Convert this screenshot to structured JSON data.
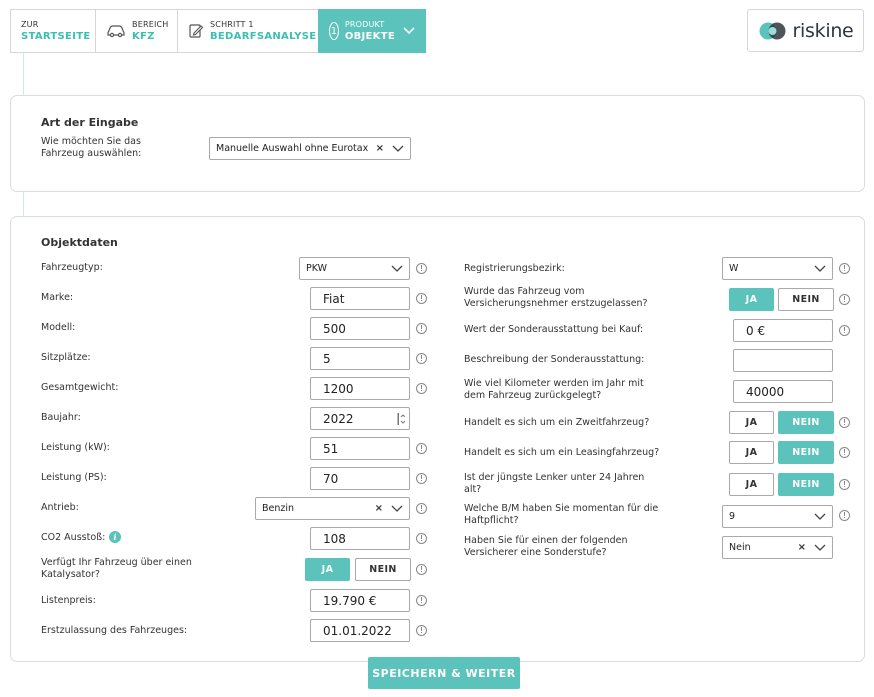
{
  "nav": {
    "home": {
      "small": "ZUR",
      "big": "STARTSEITE"
    },
    "area": {
      "small": "BEREICH",
      "big": "KFZ"
    },
    "step": {
      "small": "SCHRITT 1",
      "big": "BEDARFSANALYSE"
    },
    "product": {
      "small": "PRODUKT",
      "big": "OBJEKTE",
      "number": "1"
    }
  },
  "brand": {
    "name": "riskine",
    "accent": "#5bc3bb"
  },
  "input_type": {
    "title": "Art der Eingabe",
    "question": "Wie möchten Sie das Fahrzeug auswählen:",
    "selected": "Manuelle Auswahl ohne Eurotax"
  },
  "object": {
    "title": "Objektdaten",
    "vehicle_type": {
      "label": "Fahrzeugtyp:",
      "value": "PKW"
    },
    "brand": {
      "label": "Marke:",
      "value": "Fiat"
    },
    "model": {
      "label": "Modell:",
      "value": "500"
    },
    "seats": {
      "label": "Sitzplätze:",
      "value": "5"
    },
    "weight": {
      "label": "Gesamtgewicht:",
      "value": "1200"
    },
    "year": {
      "label": "Baujahr:",
      "value": "2022"
    },
    "power_kw": {
      "label": "Leistung (kW):",
      "value": "51"
    },
    "power_ps": {
      "label": "Leistung (PS):",
      "value": "70"
    },
    "drive": {
      "label": "Antrieb:",
      "value": "Benzin"
    },
    "co2": {
      "label": "CO2 Ausstoß:",
      "value": "108"
    },
    "catalyst": {
      "label": "Verfügt Ihr Fahrzeug über einen Katalysator?",
      "yes": "JA",
      "no": "NEIN",
      "selected": "JA"
    },
    "list_price": {
      "label": "Listenpreis:",
      "value": "19.790 €"
    },
    "first_registration": {
      "label": "Erstzulassung des Fahrzeuges:",
      "value": "01.01.2022"
    },
    "district": {
      "label": "Registrierungsbezirk:",
      "value": "W"
    },
    "first_registered_by_holder": {
      "label": "Wurde das Fahrzeug vom Versicherungsnehmer erstzugelassen?",
      "yes": "JA",
      "no": "NEIN",
      "selected": "JA"
    },
    "extras_value": {
      "label": "Wert der Sonderausstattung bei Kauf:",
      "value": "0 €"
    },
    "extras_desc": {
      "label": "Beschreibung der Sonderausstattung:",
      "value": ""
    },
    "km_per_year": {
      "label": "Wie viel Kilometer werden im Jahr mit dem Fahrzeug zurückgelegt?",
      "value": "40000"
    },
    "second_vehicle": {
      "label": "Handelt es sich um ein Zweitfahrzeug?",
      "yes": "JA",
      "no": "NEIN",
      "selected": "NEIN"
    },
    "leasing": {
      "label": "Handelt es sich um ein Leasingfahrzeug?",
      "yes": "JA",
      "no": "NEIN",
      "selected": "NEIN"
    },
    "young_driver": {
      "label": "Ist der jüngste Lenker unter 24 Jahren alt?",
      "yes": "JA",
      "no": "NEIN",
      "selected": "NEIN"
    },
    "bonus_malus": {
      "label": "Welche B/M haben Sie momentan für die Haftpflicht?",
      "value": "9"
    },
    "special_level": {
      "label": "Haben Sie für einen der folgenden Versicherer eine Sonderstufe?",
      "value": "Nein"
    }
  },
  "save_button": "SPEICHERN & WEITER"
}
